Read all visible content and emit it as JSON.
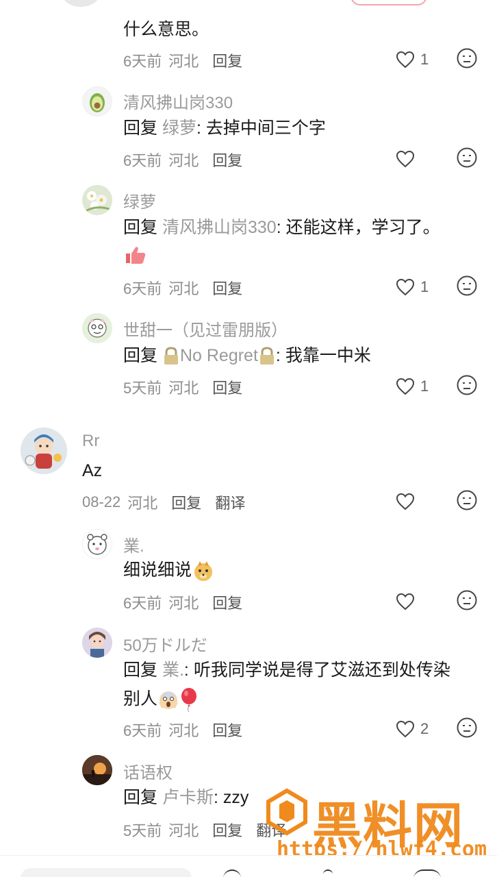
{
  "comments": [
    {
      "content": "什么意思。",
      "time": "6天前",
      "location": "河北",
      "reply_label": "回复",
      "likes": "1"
    },
    {
      "username": "清风拂山岗330",
      "reply_prefix": "回复",
      "mention": "绿萝",
      "text": ": 去掉中间三个字",
      "time": "6天前",
      "location": "河北",
      "reply_label": "回复",
      "likes": ""
    },
    {
      "username": "绿萝",
      "reply_prefix": "回复",
      "mention": "清风拂山岗330",
      "text": ": 还能这样，学习了。",
      "emoji": "thumbs-up-emoji",
      "time": "6天前",
      "location": "河北",
      "reply_label": "回复",
      "likes": "1"
    },
    {
      "username": "世甜一（见过雷朋版）",
      "reply_prefix": "回复",
      "mention": "No Regret",
      "text": ": 我靠一中米",
      "time": "5天前",
      "location": "河北",
      "reply_label": "回复",
      "likes": "1"
    },
    {
      "username": "Rr",
      "text": "Az",
      "time": "08-22",
      "location": "河北",
      "reply_label": "回复",
      "translate_label": "翻译",
      "likes": ""
    },
    {
      "username": "業.",
      "text": "细说细说",
      "time": "6天前",
      "location": "河北",
      "reply_label": "回复",
      "likes": ""
    },
    {
      "username": "50万ドルだ",
      "reply_prefix": "回复",
      "mention": "業.",
      "text": ": 听我同学说是得了艾滋还到处传染",
      "text2": "别人",
      "time": "6天前",
      "location": "河北",
      "reply_label": "回复",
      "likes": "2"
    },
    {
      "username": "话语权",
      "reply_prefix": "回复",
      "mention": "卢卡斯",
      "text": ": zzy",
      "time": "5天前",
      "location": "河北",
      "reply_label": "回复",
      "translate_label": "翻译",
      "likes": ""
    }
  ],
  "watermark": {
    "title": "黑料网",
    "url": "https://hlwf4.com"
  },
  "colors": {
    "accent_follow": "#f5a3ad",
    "watermark": "#f08a1c",
    "meta_gray": "#8c8c8c"
  }
}
